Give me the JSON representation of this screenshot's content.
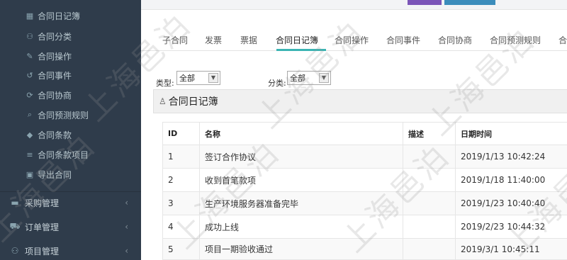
{
  "sidebar": {
    "sub_items": [
      {
        "icon": "calendar-icon",
        "glyph": "▦",
        "label": "合同日记簿"
      },
      {
        "icon": "sitemap-icon",
        "glyph": "⚇",
        "label": "合同分类"
      },
      {
        "icon": "wrench-icon",
        "glyph": "✎",
        "label": "合同操作"
      },
      {
        "icon": "undo-icon",
        "glyph": "↺",
        "label": "合同事件"
      },
      {
        "icon": "refresh-icon",
        "glyph": "⟳",
        "label": "合同协商"
      },
      {
        "icon": "search-icon",
        "glyph": "⌕",
        "label": "合同预测规则"
      },
      {
        "icon": "tags-icon",
        "glyph": "◆",
        "label": "合同条款"
      },
      {
        "icon": "list-icon",
        "glyph": "≡",
        "label": "合同条款项目"
      },
      {
        "icon": "export-icon",
        "glyph": "▣",
        "label": "导出合同"
      }
    ],
    "top_items": [
      {
        "icon": "archive-icon",
        "glyph": "▬",
        "label": "采购管理",
        "arrow": "‹"
      },
      {
        "icon": "cart-icon",
        "glyph": "⛟",
        "label": "订单管理",
        "arrow": "‹"
      },
      {
        "icon": "sitemap-icon",
        "glyph": "⚇",
        "label": "项目管理",
        "arrow": "‹"
      }
    ]
  },
  "tabs": [
    "子合同",
    "发票",
    "票据",
    "合同日记簿",
    "合同操作",
    "合同事件",
    "合同协商",
    "合同预测规则",
    "合"
  ],
  "active_tab": "合同日记簿",
  "filters": {
    "type_label": "类型:",
    "type_value": "全部",
    "category_label": "分类:",
    "category_value": "全部"
  },
  "panel": {
    "icon": "user-icon",
    "title": "合同日记簿"
  },
  "table": {
    "headers": {
      "id": "ID",
      "name": "名称",
      "desc": "描述",
      "date": "日期时间"
    },
    "rows": [
      {
        "id": "1",
        "name": "签订合作协议",
        "desc": "",
        "date": "2019/1/13 10:42:24"
      },
      {
        "id": "2",
        "name": "收到首笔款项",
        "desc": "",
        "date": "2019/1/18 11:40:00"
      },
      {
        "id": "3",
        "name": "生产环境服务器准备完毕",
        "desc": "",
        "date": "2019/1/23 10:40:40"
      },
      {
        "id": "4",
        "name": "成功上线",
        "desc": "",
        "date": "2019/2/23 10:44:32"
      },
      {
        "id": "5",
        "name": "项目一期验收通过",
        "desc": "",
        "date": "2019/3/1 10:45:11"
      }
    ]
  },
  "watermark": "上海邑泊",
  "colors": {
    "sidebar_bg": "#2f3c4b",
    "tab_underline": "#3bb4b3",
    "button_purple": "#7b55b8",
    "button_blue": "#3c8dbc"
  }
}
